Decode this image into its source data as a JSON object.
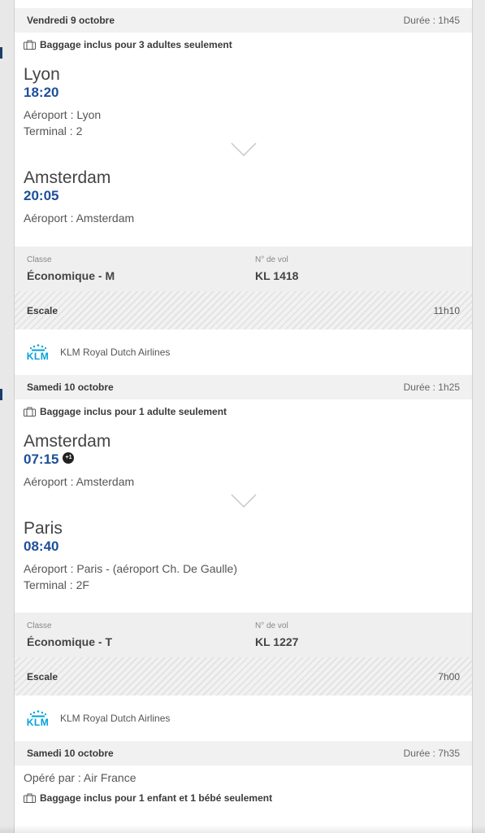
{
  "segments": [
    {
      "date": "Vendredi 9 octobre",
      "duration": "Durée : 1h45",
      "baggage": "Baggage inclus pour 3 adultes seulement",
      "departure": {
        "city": "Lyon",
        "time": "18:20",
        "airport": "Aéroport : Lyon",
        "terminal": "Terminal : 2"
      },
      "arrival": {
        "city": "Amsterdam",
        "time": "20:05",
        "airport": "Aéroport : Amsterdam"
      },
      "class_label": "Classe",
      "class_value": "Économique - M",
      "flight_label": "N° de vol",
      "flight_value": "KL 1418"
    },
    {
      "date": "Samedi 10 octobre",
      "duration": "Durée : 1h25",
      "baggage": "Baggage inclus pour 1 adulte seulement",
      "departure": {
        "city": "Amsterdam",
        "time": "07:15",
        "day_offset": "+1",
        "airport": "Aéroport : Amsterdam"
      },
      "arrival": {
        "city": "Paris",
        "time": "08:40",
        "airport": "Aéroport : Paris - (aéroport Ch. De Gaulle)",
        "terminal": "Terminal : 2F"
      },
      "class_label": "Classe",
      "class_value": "Économique - T",
      "flight_label": "N° de vol",
      "flight_value": "KL 1227"
    },
    {
      "date": "Samedi 10 octobre",
      "duration": "Durée : 7h35",
      "operated_by": "Opéré par : Air France",
      "baggage": "Baggage inclus pour 1 enfant et 1 bébé seulement"
    }
  ],
  "stopovers": [
    {
      "label": "Escale",
      "duration": "11h10"
    },
    {
      "label": "Escale",
      "duration": "7h00"
    }
  ],
  "airlines": [
    {
      "logo_text": "KLM",
      "name": "KLM Royal Dutch Airlines"
    },
    {
      "logo_text": "KLM",
      "name": "KLM Royal Dutch Airlines"
    }
  ],
  "colors": {
    "time_blue": "#1d4f9a",
    "klm_blue": "#00a1de",
    "bar_grey": "#f1f1f1"
  },
  "icons": {
    "baggage": "briefcase-icon",
    "expand": "chevron-down-icon",
    "airline": "klm-crown-icon"
  }
}
